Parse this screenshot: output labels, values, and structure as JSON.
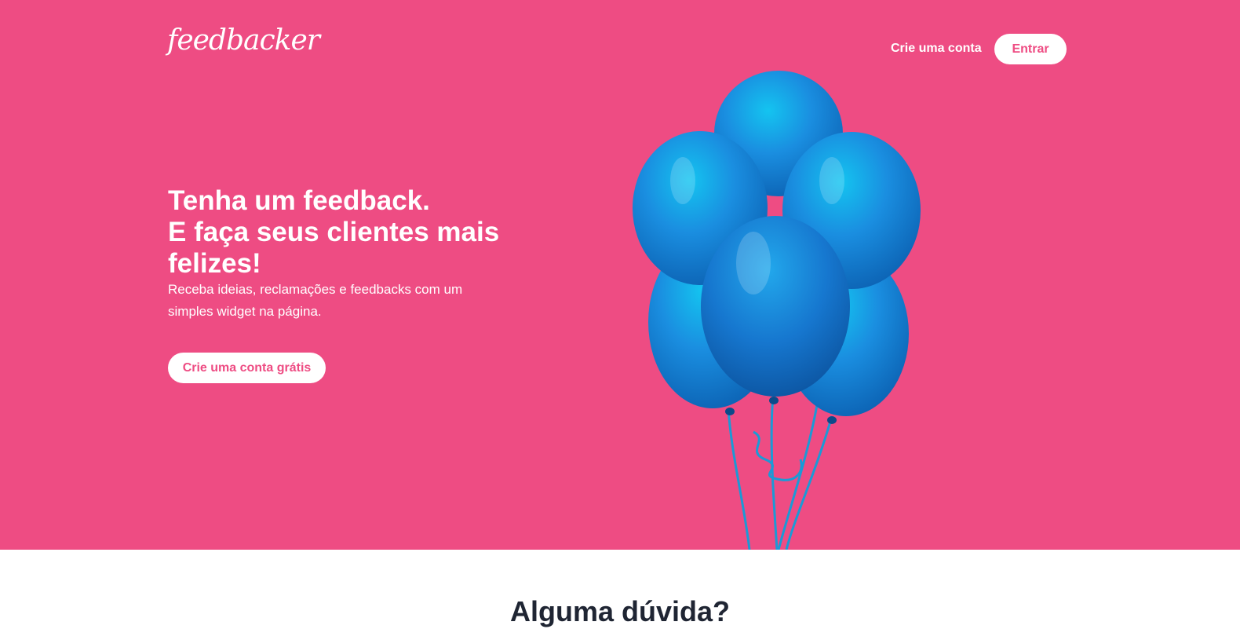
{
  "header": {
    "logo": "feedbacker",
    "signup_link": "Crie uma conta",
    "login_button": "Entrar"
  },
  "hero": {
    "headline_lines": [
      "Tenha um feedback.",
      "E faça seus clientes mais",
      "felizes!"
    ],
    "subtext": "Receba ideias, reclamações e feedbacks com um simples widget na página.",
    "cta_button": "Crie uma conta grátis",
    "illustration": "blue-balloons-image"
  },
  "faq": {
    "title": "Alguma dúvida?"
  },
  "colors": {
    "brand_pink": "#ee4c83",
    "white": "#ffffff",
    "balloon_blue": "#1a86d6",
    "dark_text": "#1f2533"
  }
}
